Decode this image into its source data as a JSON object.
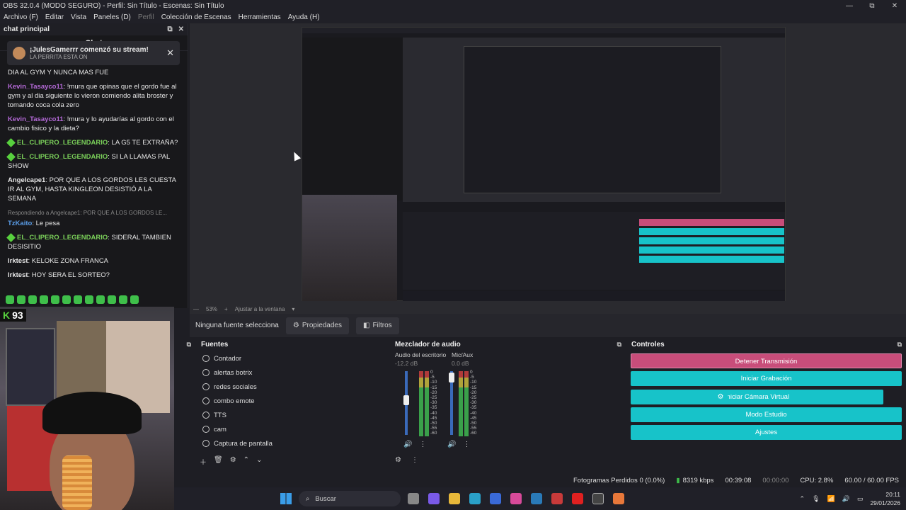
{
  "window": {
    "title": "OBS 32.0.4 (MODO SEGURO) - Perfil: Sin Título - Escenas: Sin Título",
    "controls": [
      "—",
      "⧉",
      "✕"
    ]
  },
  "menu": [
    "Archivo (F)",
    "Editar",
    "Vista",
    "Paneles (D)",
    "Perfil",
    "Colección de Escenas",
    "Herramientas",
    "Ayuda (H)"
  ],
  "chat_dock": {
    "dock_title": "chat principal",
    "chat_title": "Chat",
    "notice": {
      "title": "¡JulesGamerrr comenzó su stream!",
      "subtitle": "LA PERRITA ESTA ON"
    },
    "messages": [
      {
        "user": "",
        "text": "DIA AL GYM Y NUNCA MAS FUE"
      },
      {
        "user": "Kevin_Tasayco11",
        "text": ": !mura que opinas que el gordo fue al gym y al dia siguiente lo vieron comiendo alita broster y tomando coca cola zero"
      },
      {
        "user": "Kevin_Tasayco11",
        "text": ": !mura y lo ayudarías al gordo con el cambio fisico y la dieta?"
      },
      {
        "user": "EL_CLIPERO_LEGENDARIO",
        "text": ": LA G5 TE EXTRAÑA?"
      },
      {
        "user": "EL_CLIPERO_LEGENDARIO",
        "text": ": SI LA LLAMAS PAL SHOW"
      },
      {
        "user": "Angelcape1",
        "text": ": POR QUE A LOS GORDOS LES CUESTA IR AL GYM, HASTA KINGLEON DESISTIÓ A LA SEMANA"
      },
      {
        "reply": "Respondiendo a Angelcape1: POR QUE A LOS GORDOS LE...",
        "user": "TzKaito",
        "text": ": Le pesa"
      },
      {
        "user": "EL_CLIPERO_LEGENDARIO",
        "text": ": SIDERAL TAMBIEN DESISITIO"
      },
      {
        "user": "Irktest",
        "text": ": KELOKE ZONA FRANCA"
      },
      {
        "user": "Irktest",
        "text": ": HOY SERA EL SORTEO?"
      }
    ],
    "score": "93"
  },
  "preview": {
    "zoom": "53%",
    "fit_label": "Ajustar a la ventana"
  },
  "source_bar": {
    "label": "Ninguna fuente selecciona",
    "props": "Propiedades",
    "filters": "Filtros"
  },
  "fuentes": {
    "title": "Fuentes",
    "items": [
      "Contador",
      "alertas botrix",
      "redes sociales",
      "combo emote",
      "TTS",
      "cam",
      "Captura de pantalla"
    ]
  },
  "mixer": {
    "title": "Mezclador de audio",
    "channels": [
      {
        "name": "Audio del escritorio",
        "db": "-12.2 dB"
      },
      {
        "name": "Mic/Aux",
        "db": "0.0 dB"
      }
    ],
    "scale": [
      "0",
      "-5",
      "-10",
      "-15",
      "-20",
      "-25",
      "-30",
      "-35",
      "-40",
      "-45",
      "-50",
      "-55",
      "-60"
    ]
  },
  "controles": {
    "title": "Controles",
    "buttons": [
      "Detener Transmisión",
      "Iniciar Grabación",
      "Iniciar Cámara Virtual",
      "Modo Estudio",
      "Ajustes"
    ]
  },
  "status": {
    "frames": "Fotogramas Perdidos 0 (0.0%)",
    "kbps": "8319 kbps",
    "stream_time": "00:39:08",
    "rec_time": "00:00:00",
    "cpu": "CPU: 2.8%",
    "fps": "60.00 / 60.00 FPS"
  },
  "taskbar": {
    "search": "Buscar",
    "time": "20:11",
    "date": "29/01/2026"
  },
  "colors": {
    "accent": "#17c3c9",
    "stop": "#c84d7a",
    "bg": "#1e1e24"
  }
}
